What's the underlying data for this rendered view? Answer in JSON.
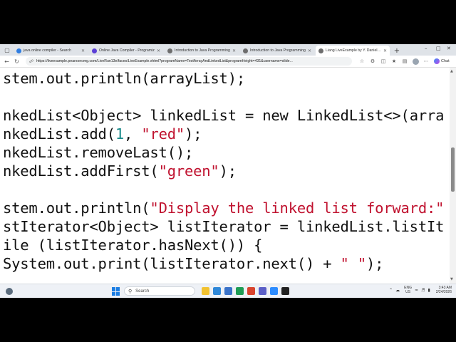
{
  "browser": {
    "tabs": [
      {
        "title": "java online compiler - Search",
        "favicon_color": "#2f7de1",
        "active": false
      },
      {
        "title": "Online Java Compiler - Programiz",
        "favicon_color": "#5b3fd6",
        "active": false
      },
      {
        "title": "Introduction to Java Programming",
        "favicon_color": "#6d6d6d",
        "active": false
      },
      {
        "title": "Introduction to Java Programming",
        "favicon_color": "#6d6d6d",
        "active": false
      },
      {
        "title": "Liang LiveExample by Y. Daniel Liang",
        "favicon_color": "#6d6d6d",
        "active": true
      }
    ],
    "new_tab_label": "+",
    "url": "https://liveexample.pearsoncmg.com/LiveRun13e/faces/LiveExample.xhtml?programName=TestArrayAndLinkedList&programHeight=431&username=slide...",
    "copilot_label": "Chat"
  },
  "code": {
    "lines": [
      [
        {
          "t": "stem.out.println(arrayList);",
          "c": "plain"
        }
      ],
      [],
      [
        {
          "t": "nkedList<Object> linkedList = ",
          "c": "plain"
        },
        {
          "t": "new",
          "c": "kw"
        },
        {
          "t": " LinkedList<>(arra",
          "c": "plain"
        }
      ],
      [
        {
          "t": "nkedList.add(",
          "c": "plain"
        },
        {
          "t": "1",
          "c": "num"
        },
        {
          "t": ", ",
          "c": "plain"
        },
        {
          "t": "\"red\"",
          "c": "str"
        },
        {
          "t": ");",
          "c": "plain"
        }
      ],
      [
        {
          "t": "nkedList.removeLast();",
          "c": "plain"
        }
      ],
      [
        {
          "t": "nkedList.addFirst(",
          "c": "plain"
        },
        {
          "t": "\"green\"",
          "c": "str"
        },
        {
          "t": ");",
          "c": "plain"
        }
      ],
      [],
      [
        {
          "t": "stem.out.println(",
          "c": "plain"
        },
        {
          "t": "\"Display the linked list forward:\"",
          "c": "str"
        }
      ],
      [
        {
          "t": "stIterator<Object> listIterator = linkedList.listIt",
          "c": "plain"
        }
      ],
      [
        {
          "t": "ile (listIterator.hasNext()) {",
          "c": "plain"
        }
      ],
      [
        {
          "t": "System.out.print(listIterator.next() + ",
          "c": "plain"
        },
        {
          "t": "\" \"",
          "c": "str"
        },
        {
          "t": ");",
          "c": "plain"
        }
      ]
    ]
  },
  "taskbar": {
    "search_placeholder": "Search",
    "apps": [
      "file-explorer",
      "edge",
      "store",
      "chrome",
      "office",
      "teams",
      "zoom",
      "media"
    ],
    "app_colors": [
      "#f2c230",
      "#2f88d8",
      "#3a73c9",
      "#1f9d55",
      "#d9442e",
      "#5b5fc7",
      "#2d8cff",
      "#222222"
    ],
    "lang_line1": "ENG",
    "lang_line2": "US",
    "time": "3:43 AM",
    "date": "2/24/2026"
  }
}
